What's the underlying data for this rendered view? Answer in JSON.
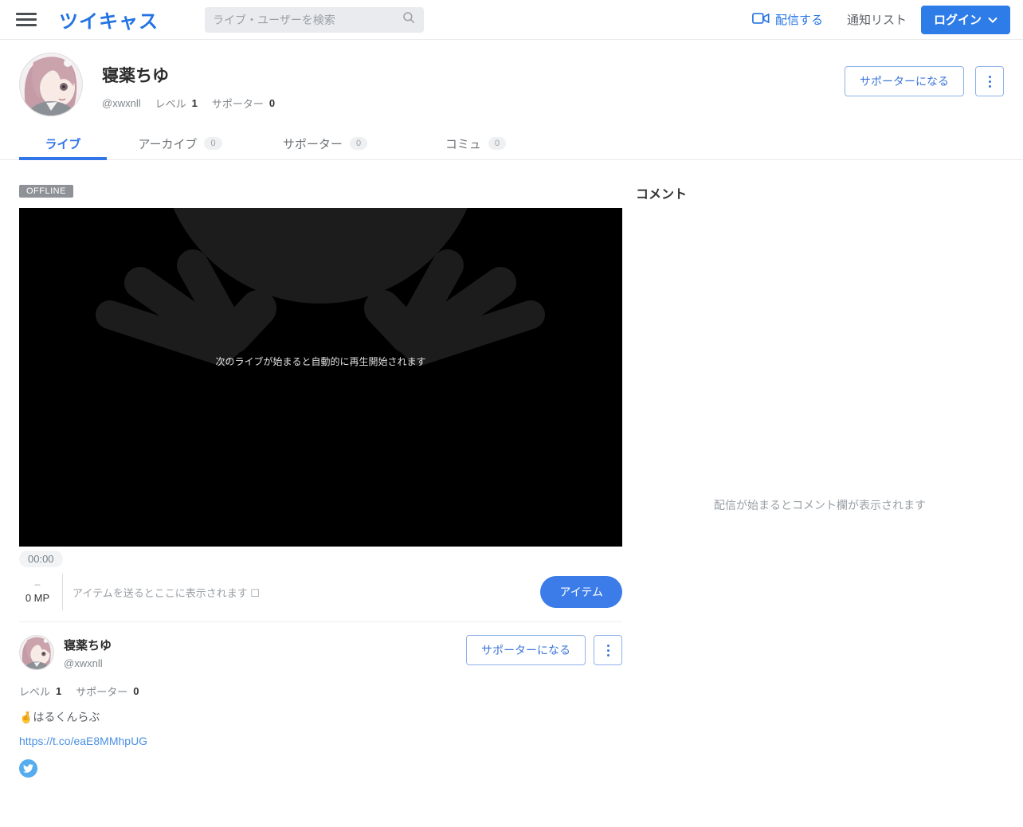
{
  "header": {
    "logo": "ツイキャス",
    "search_placeholder": "ライブ・ユーザーを検索",
    "broadcast_label": "配信する",
    "notifications_label": "通知リスト",
    "login_label": "ログイン"
  },
  "profile": {
    "name": "寝薬ちゆ",
    "handle": "@xwxnll",
    "level_label": "レベル",
    "level_value": "1",
    "supporter_label": "サポーター",
    "supporter_value": "0",
    "become_supporter_label": "サポーターになる"
  },
  "tabs": [
    {
      "label": "ライブ",
      "active": true
    },
    {
      "label": "アーカイブ",
      "badge": "0"
    },
    {
      "label": "サポーター",
      "badge": "0"
    },
    {
      "label": "コミュ",
      "badge": "0"
    }
  ],
  "player": {
    "offline_badge": "OFFLINE",
    "offline_message": "次のライブが始まると自動的に再生開始されます",
    "time": "00:00"
  },
  "item_bar": {
    "dash": "–",
    "mp_value": "0 MP",
    "placeholder": "アイテムを送るとここに表示されます ☐",
    "item_button_label": "アイテム"
  },
  "streamer_card": {
    "name": "寝薬ちゆ",
    "handle": "@xwxnll",
    "level_label": "レベル",
    "level_value": "1",
    "supporter_label": "サポーター",
    "supporter_value": "0",
    "become_supporter_label": "サポーターになる",
    "bio": "🤞はるくんらぶ",
    "link": "https://t.co/eaE8MMhpUG"
  },
  "comments": {
    "title": "コメント",
    "empty_message": "配信が始まるとコメント欄が表示されます"
  },
  "colors": {
    "primary_blue": "#2e7ce8",
    "link_blue": "#4a90e2",
    "twitter_blue": "#55acee"
  }
}
